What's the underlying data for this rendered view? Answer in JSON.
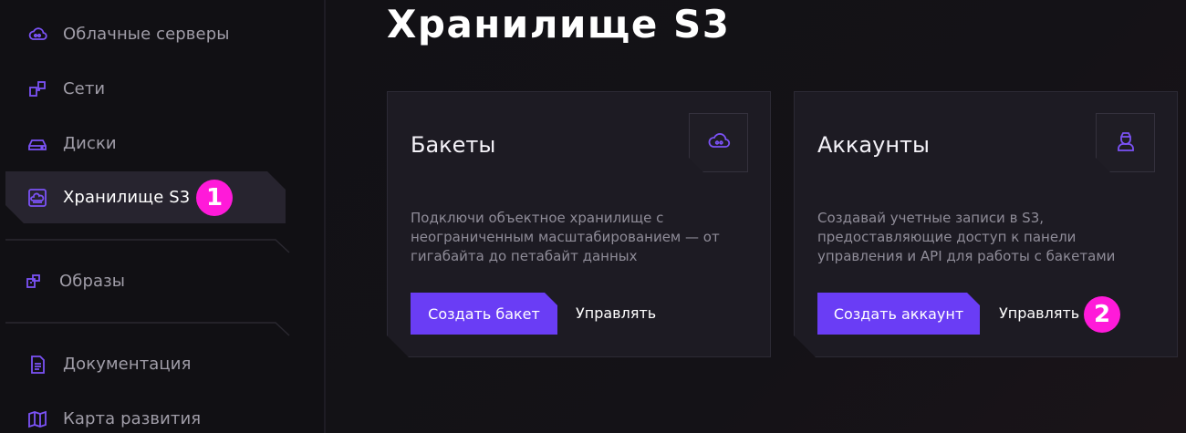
{
  "sidebar": {
    "items": [
      {
        "label": "Облачные серверы",
        "icon": "cloud-server-icon"
      },
      {
        "label": "Сети",
        "icon": "network-icon"
      },
      {
        "label": "Диски",
        "icon": "disk-icon"
      },
      {
        "label": "Хранилище S3",
        "icon": "storage-icon",
        "active": true
      },
      {
        "label": "Образы",
        "icon": "image-icon"
      },
      {
        "label": "Документация",
        "icon": "document-icon"
      },
      {
        "label": "Карта развития",
        "icon": "map-icon"
      }
    ]
  },
  "markers": [
    "1",
    "2"
  ],
  "page": {
    "title": "Хранилище S3"
  },
  "cards": [
    {
      "title": "Бакеты",
      "icon": "cloud-icon",
      "description": "Подключи объектное хранилище с неограниченным масштабированием — от гигабайта до петабайт данных",
      "primary": "Создать бакет",
      "secondary": "Управлять"
    },
    {
      "title": "Аккаунты",
      "icon": "user-icon",
      "description": "Создавай учетные записи в S3, предоставляющие доступ к панели управления и API для работы с бакетами",
      "primary": "Создать аккаунт",
      "secondary": "Управлять"
    }
  ],
  "colors": {
    "accent": "#6a3df5",
    "icon": "#7b52f6",
    "marker": "#ff1ad9"
  }
}
